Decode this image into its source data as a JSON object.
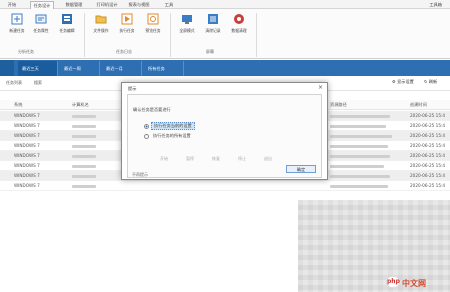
{
  "ribbon": {
    "tabs": [
      "开始",
      "任务设计",
      "数据管理",
      "打印机设计",
      "报表与视图",
      "工具"
    ],
    "title": "工具箱",
    "buttons": [
      {
        "label": "新建任务",
        "icon": "new-task-icon"
      },
      {
        "label": "任务属性",
        "icon": "task-properties-icon"
      },
      {
        "label": "任务编辑",
        "icon": "task-edit-icon"
      },
      {
        "label": "文件操作",
        "icon": "folder-icon"
      },
      {
        "label": "执行任务",
        "icon": "run-task-icon"
      },
      {
        "label": "预览任务",
        "icon": "preview-icon"
      },
      {
        "label": "全屏模式",
        "icon": "monitor-icon"
      },
      {
        "label": "清除记录",
        "icon": "clear-records-icon"
      },
      {
        "label": "数据清理",
        "icon": "data-cleanup-icon"
      }
    ],
    "groups": [
      "分析任务",
      "任务日志",
      "屏幕"
    ]
  },
  "bluebar": {
    "tabs": [
      "最近三天",
      "最近一周",
      "最近一月",
      "所有任务"
    ]
  },
  "toolbar": {
    "items": [
      "任务列表",
      "搜索"
    ],
    "right_items": [
      "显示设置",
      "刷新"
    ]
  },
  "table": {
    "headers": [
      "系统",
      "计算机名",
      "资源路径",
      "创建时间"
    ],
    "rows": [
      {
        "system": "WINDOWS 7",
        "date": "2020-06-25 15:4"
      },
      {
        "system": "WINDOWS 7",
        "date": "2020-06-25 15:4"
      },
      {
        "system": "WINDOWS 7",
        "date": "2020-06-25 15:4"
      },
      {
        "system": "WINDOWS 7",
        "date": "2020-06-25 15:4"
      },
      {
        "system": "WINDOWS 7",
        "date": "2020-06-25 15:4"
      },
      {
        "system": "WINDOWS 7",
        "date": "2020-06-25 15:4"
      },
      {
        "system": "WINDOWS 7",
        "date": "2020-06-25 15:4"
      },
      {
        "system": "WINDOWS 7",
        "date": "2020-06-25 15:4"
      }
    ]
  },
  "dialog": {
    "title": "提示",
    "close": "×",
    "question": "确认任务是否要进行",
    "options": [
      "执行任务当前的设置",
      "执行任务的所有设置"
    ],
    "dimmed": [
      "开始",
      "暂停",
      "恢复",
      "停止",
      "退出"
    ],
    "extra": "不再提示",
    "ok": "确定"
  },
  "watermark": {
    "text": "中文网",
    "logo": "php"
  }
}
